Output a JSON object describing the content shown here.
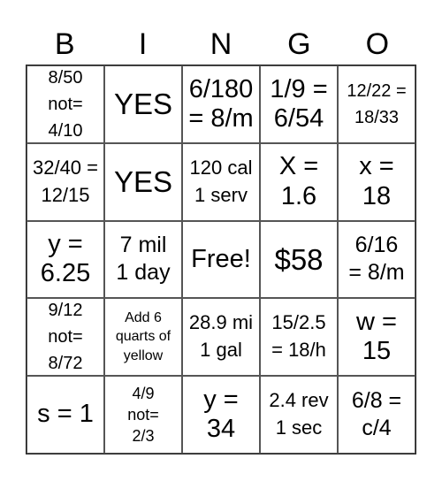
{
  "header": [
    "B",
    "I",
    "N",
    "G",
    "O"
  ],
  "cells": [
    [
      "8/50\nnot=\n4/10",
      "YES",
      "6/180\n= 8/m",
      "1/9 =\n6/54",
      "12/22 =\n18/33"
    ],
    [
      "32/40 =\n12/15",
      "YES",
      "120 cal\n1 serv",
      "X =\n1.6",
      "x =\n18"
    ],
    [
      "y =\n6.25",
      "7 mil\n1 day",
      "Free!",
      "$58",
      "6/16\n= 8/m"
    ],
    [
      "9/12\nnot=\n8/72",
      "Add 6\nquarts of\nyellow",
      "28.9 mi\n1 gal",
      "15/2.5\n= 18/h",
      "w =\n15"
    ],
    [
      "s = 1",
      "4/9\nnot=\n2/3",
      "y =\n34",
      "2.4 rev\n1 sec",
      "6/8 =\nc/4"
    ]
  ]
}
